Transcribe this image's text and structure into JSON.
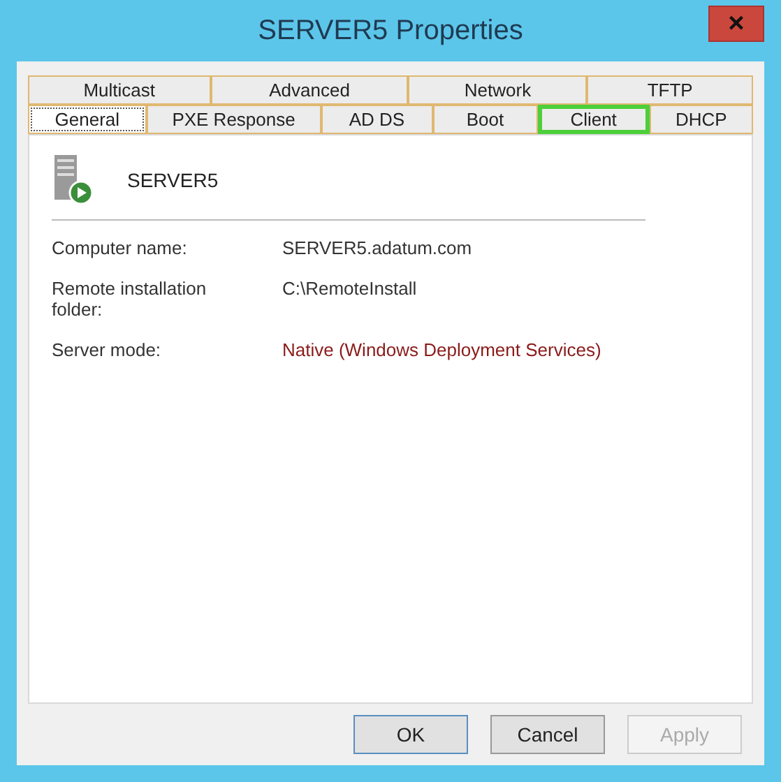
{
  "window": {
    "title": "SERVER5 Properties",
    "close": "×"
  },
  "tab_rows": [
    [
      {
        "label": "Multicast",
        "selected": false,
        "highlighted": false
      },
      {
        "label": "Advanced",
        "selected": false,
        "highlighted": false
      },
      {
        "label": "Network",
        "selected": false,
        "highlighted": false
      },
      {
        "label": "TFTP",
        "selected": false,
        "highlighted": false
      }
    ],
    [
      {
        "label": "General",
        "selected": true,
        "highlighted": false
      },
      {
        "label": "PXE Response",
        "selected": false,
        "highlighted": false
      },
      {
        "label": "AD DS",
        "selected": false,
        "highlighted": false
      },
      {
        "label": "Boot",
        "selected": false,
        "highlighted": false
      },
      {
        "label": "Client",
        "selected": false,
        "highlighted": true
      },
      {
        "label": "DHCP",
        "selected": false,
        "highlighted": false
      }
    ]
  ],
  "server": {
    "name": "SERVER5"
  },
  "properties": [
    {
      "label": "Computer name:",
      "value": "SERVER5.adatum.com",
      "kind": "normal"
    },
    {
      "label": "Remote installation folder:",
      "value": "C:\\RemoteInstall",
      "kind": "normal"
    },
    {
      "label": "Server mode:",
      "value": "Native (Windows Deployment Services)",
      "kind": "status"
    }
  ],
  "buttons": [
    {
      "label": "OK",
      "default": true,
      "disabled": false
    },
    {
      "label": "Cancel",
      "default": false,
      "disabled": false
    },
    {
      "label": "Apply",
      "default": false,
      "disabled": true
    }
  ]
}
